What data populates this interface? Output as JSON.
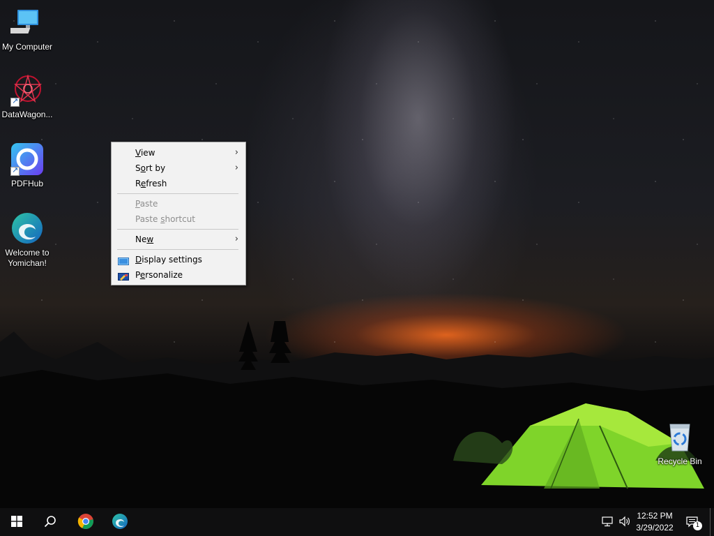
{
  "desktop_icons": [
    {
      "label": "My Computer",
      "icon": "computer-icon"
    },
    {
      "label": "DataWagon...",
      "icon": "datawagon-icon"
    },
    {
      "label": "PDFHub",
      "icon": "pdfhub-icon"
    },
    {
      "label": "Welcome to\nYomichan!",
      "label_line1": "Welcome to",
      "label_line2": "Yomichan!",
      "icon": "edge-icon"
    },
    {
      "label": "Recycle Bin",
      "icon": "recycle-bin-icon"
    }
  ],
  "context_menu": {
    "items": [
      {
        "prefix": "",
        "key": "V",
        "rest": "iew",
        "submenu": true,
        "enabled": true
      },
      {
        "prefix": "S",
        "key": "o",
        "rest": "rt by",
        "submenu": true,
        "enabled": true
      },
      {
        "prefix": "R",
        "key": "e",
        "rest": "fresh",
        "submenu": false,
        "enabled": true
      },
      {
        "prefix": "",
        "key": "P",
        "rest": "aste",
        "submenu": false,
        "enabled": false
      },
      {
        "prefix": "Paste ",
        "key": "s",
        "rest": "hortcut",
        "submenu": false,
        "enabled": false
      },
      {
        "prefix": "Ne",
        "key": "w",
        "rest": "",
        "submenu": true,
        "enabled": true
      },
      {
        "prefix": "",
        "key": "D",
        "rest": "isplay settings",
        "submenu": false,
        "enabled": true,
        "icon": "display-icon"
      },
      {
        "prefix": "P",
        "key": "e",
        "rest": "rsonalize",
        "submenu": false,
        "enabled": true,
        "icon": "personalize-icon"
      }
    ],
    "submenu_arrow": "›"
  },
  "taskbar": {
    "pinned": [
      "start-icon",
      "search-icon",
      "chrome-icon",
      "edge-icon"
    ],
    "tray": {
      "time": "12:52 PM",
      "date": "3/29/2022",
      "notification_count": "1"
    }
  },
  "colors": {
    "menu_bg": "#f2f2f2",
    "taskbar_bg": "#0f0f10",
    "disabled_text": "#8d8d8d"
  }
}
